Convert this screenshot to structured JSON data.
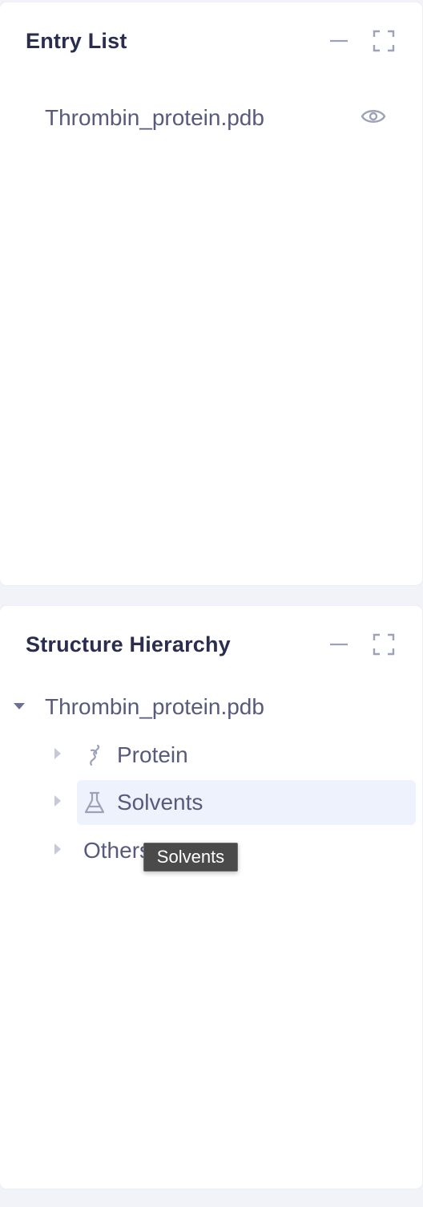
{
  "entry_list": {
    "title": "Entry List",
    "items": [
      {
        "name": "Thrombin_protein.pdb",
        "icon": "eye-icon"
      }
    ]
  },
  "structure_hierarchy": {
    "title": "Structure Hierarchy",
    "root": {
      "label": "Thrombin_protein.pdb",
      "expanded": true
    },
    "children": [
      {
        "label": "Protein",
        "icon": "protein-icon",
        "expanded": false
      },
      {
        "label": "Solvents",
        "icon": "flask-icon",
        "expanded": false,
        "hovered": true
      },
      {
        "label": "Others",
        "icon": "",
        "expanded": false
      }
    ],
    "tooltip": "Solvents"
  },
  "colors": {
    "background": "#f1f3f8",
    "panel": "#ffffff",
    "title": "#2b2d4f",
    "text": "#575a7b",
    "icon": "#9ea2b8",
    "highlight": "#eef2fd",
    "tooltip_bg": "#4a4a4a"
  }
}
